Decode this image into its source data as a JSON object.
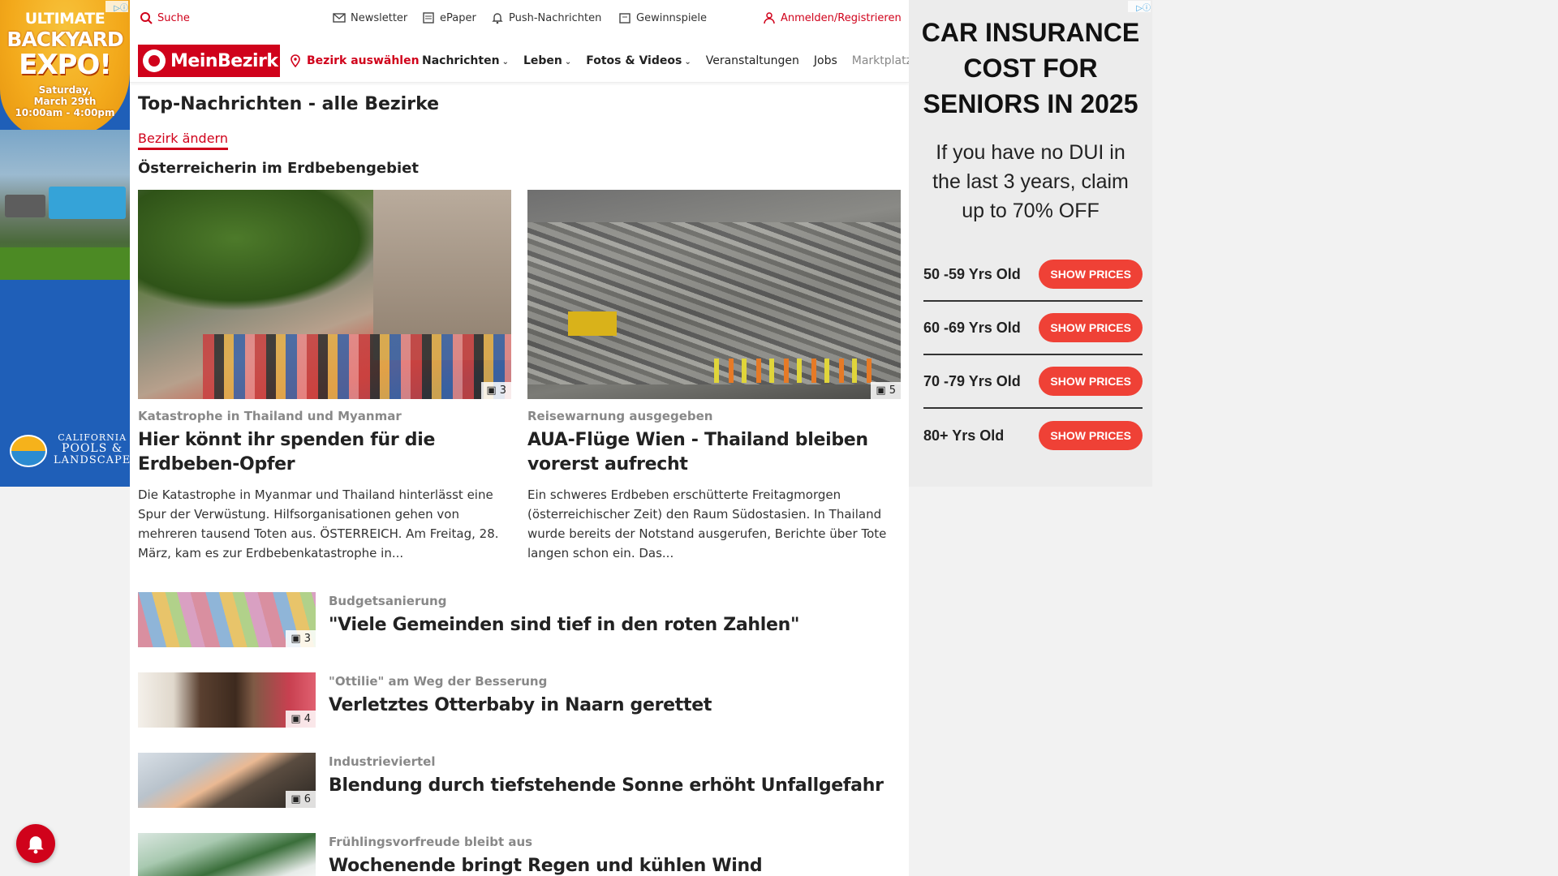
{
  "left_ad": {
    "line1": "ULTIMATE",
    "line2": "BACKYARD",
    "line3": "EXPO!",
    "date": "Saturday,",
    "date2": "March 29th",
    "time": "10:00am - 4:00pm",
    "logo_line1": "CALIFORNIA",
    "logo_line2": "POOLS &",
    "logo_line3": "LANDSCAPE"
  },
  "topbar": {
    "search": "Suche",
    "newsletter": "Newsletter",
    "epaper": "ePaper",
    "push": "Push-Nachrichten",
    "games": "Gewinnspiele",
    "login": "Anmelden/Registrieren"
  },
  "nav": {
    "brand": "MeinBezirk",
    "bezirk": "Bezirk auswählen",
    "items": [
      "Nachrichten",
      "Leben",
      "Fotos & Videos",
      "Veranstaltungen",
      "Jobs",
      "Marktplatz"
    ]
  },
  "page": {
    "title": "Top-Nachrichten - alle Bezirke",
    "change": "Bezirk ändern",
    "section": "Österreicherin im Erdbebengebiet"
  },
  "top_articles": [
    {
      "kicker": "Katastrophe in Thailand und Myanmar",
      "headline": "Hier könnt ihr spenden für die Erdbeben-Opfer",
      "teaser": "Die Katastrophe in Myanmar und Thailand hinterlässt eine Spur der Verwüstung. Hilfsorganisationen gehen von mehreren tausend Toten aus.  ÖSTERREICH. Am Freitag, 28. März, kam es zur Erdbebenkatastrophe in...",
      "photos": "3"
    },
    {
      "kicker": "Reisewarnung ausgegeben",
      "headline": "AUA-Flüge Wien - Thailand bleiben vorerst aufrecht",
      "teaser": "Ein schweres Erdbeben erschütterte Freitagmorgen (österreichischer Zeit) den Raum Südostasien. In Thailand wurde bereits der Notstand ausgerufen, Berichte über Tote langen schon ein. Das...",
      "photos": "5"
    }
  ],
  "list": [
    {
      "kicker": "Budgetsanierung",
      "headline": "\"Viele Gemeinden sind tief in den roten Zahlen\"",
      "photos": "3"
    },
    {
      "kicker": "\"Ottilie\" am Weg der Besserung",
      "headline": "Verletztes Otterbaby in Naarn gerettet",
      "photos": "4"
    },
    {
      "kicker": "Industrieviertel",
      "headline": "Blendung durch tiefstehende Sonne erhöht Unfallgefahr",
      "photos": "6"
    },
    {
      "kicker": "Frühlingsvorfreude bleibt aus",
      "headline": "Wochenende bringt Regen und kühlen Wind",
      "photos": ""
    }
  ],
  "right_ad": {
    "title_l1": "CAR INSURANCE",
    "title_l2": "COST FOR",
    "title_l3": "SENIORS IN 2025",
    "sub_l1": "If you have no DUI in",
    "sub_l2": "the last 3 years, claim",
    "sub_l3": "up to 70% OFF",
    "rows": [
      {
        "age": "50 -59 Yrs Old",
        "button": "SHOW PRICES"
      },
      {
        "age": "60 -69 Yrs Old",
        "button": "SHOW PRICES"
      },
      {
        "age": "70 -79 Yrs Old",
        "button": "SHOW PRICES"
      },
      {
        "age": "80+ Yrs Old",
        "button": "SHOW PRICES"
      }
    ]
  },
  "colors": {
    "brand": "#d0021b",
    "ad_button": "#ef4136",
    "left_ad_bg": "#1f5fb8"
  }
}
